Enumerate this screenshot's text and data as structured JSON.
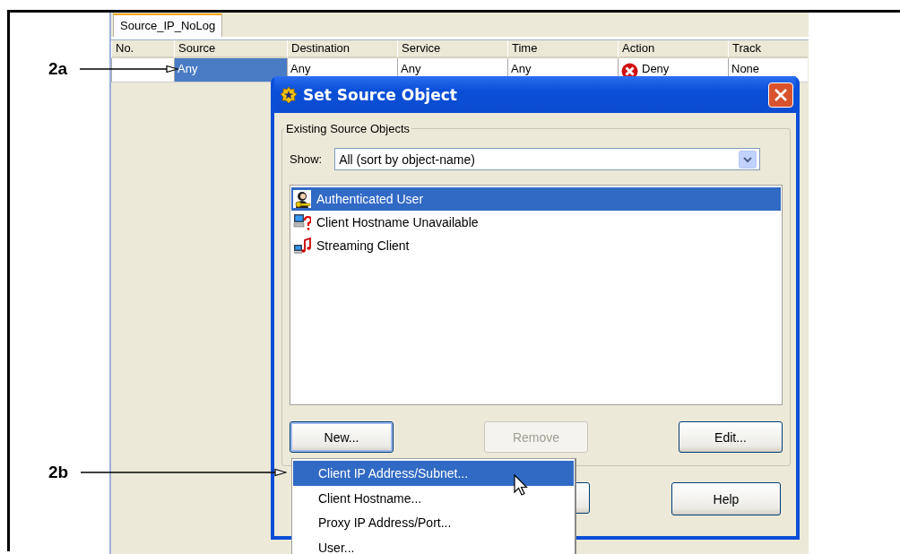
{
  "tab": {
    "label": "Source_IP_NoLog",
    "selected": true
  },
  "table": {
    "columns": [
      "No.",
      "Source",
      "Destination",
      "Service",
      "Time",
      "Action",
      "Track"
    ],
    "rows": [
      {
        "cells": [
          {
            "kind": "number",
            "selected": false
          },
          {
            "text": "Any",
            "kind": "plain",
            "selected": true
          },
          {
            "text": "Any",
            "kind": "plain",
            "selected": false
          },
          {
            "text": "Any",
            "kind": "plain",
            "selected": false
          },
          {
            "text": "Any",
            "kind": "plain",
            "selected": false
          },
          {
            "text": "Deny",
            "kind": "deny",
            "selected": false
          },
          {
            "text": "None",
            "kind": "plain",
            "selected": false
          }
        ]
      }
    ]
  },
  "dialog": {
    "title": "Set Source Object",
    "group_label": "Existing Source Objects",
    "show_label": "Show:",
    "show_value": "All (sort by object-name)",
    "items": [
      {
        "label": "Authenticated User",
        "kind": "user",
        "selected": true
      },
      {
        "label": "Client Hostname Unavailable",
        "kind": "host-unknown",
        "selected": false
      },
      {
        "label": "Streaming Client",
        "kind": "streaming",
        "selected": false
      }
    ],
    "buttons": [
      {
        "label": "New...",
        "disabled": false
      },
      {
        "label": "Remove",
        "disabled": true
      },
      {
        "label": "Edit..."
      }
    ],
    "bottom_buttons": [
      {
        "label": "Help"
      }
    ]
  },
  "menu": {
    "items": [
      {
        "label": "Client IP Address/Subnet...",
        "selected": true
      },
      {
        "label": "Client Hostname...",
        "selected": false
      },
      {
        "label": "Proxy IP Address/Port...",
        "selected": false
      },
      {
        "label": "User...",
        "selected": false
      }
    ]
  },
  "callouts": [
    {
      "label": "2a"
    },
    {
      "label": "2b"
    }
  ]
}
